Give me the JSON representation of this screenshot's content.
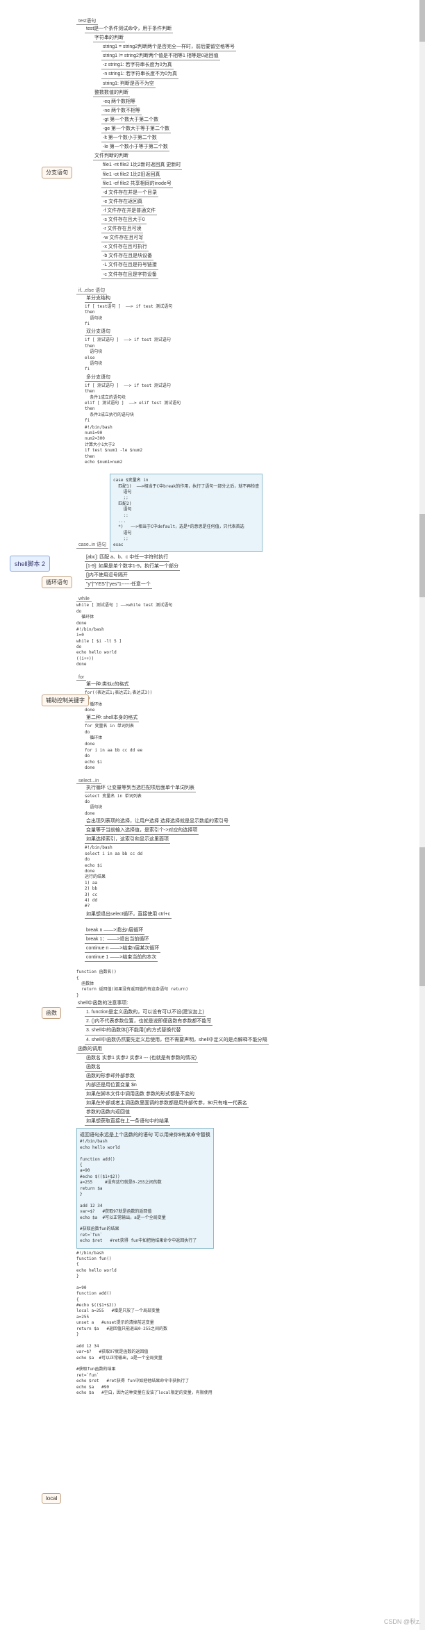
{
  "root": "shell脚本 2",
  "watermark": "CSDN @秋z.",
  "b1": {
    "label": "分支语句",
    "n1": "test语句",
    "n1_desc": "test是一个条件测试命令，用于条件判断",
    "str": {
      "t": "字符串的判断",
      "a": "string1 = string2判断两个是否完全一样时，前后要留空格等号",
      "b": "string1 != string2判断两个值是不相等1 相等是0返回值",
      "c": "-z string1: 若字符串长度为0为真",
      "d": "-n string1: 若字符串长度不为0为真",
      "e": "string1: 判断是否不为空"
    },
    "num": {
      "t": "整数数值的判断",
      "a": "-eq 两个数相等",
      "b": "-ne 两个数不相等",
      "c": "-gt 第一个数大于第二个数",
      "d": "-ge 第一个数大于等于第二个数",
      "e": "-lt 第一个数小于第二个数",
      "f": "-le 第一个数小于等于第二个数"
    },
    "file": {
      "t": "文件判断的判断",
      "a": "file1 -nt file2 1比2新时返回真 更新时",
      "b": "file1 -ot file2 1比2旧返回真",
      "c": "file1 -ef file2 共享相同的inode号",
      "d": "-d 文件存在并是一个目录",
      "e": "-e 文件存在返回真",
      "f": "-f 文件存在并是普通文件",
      "g": "-s 文件存在且大于0",
      "h": "-r 文件存在且可读",
      "i": "-w 文件存在且可写",
      "j": "-x 文件存在且可执行",
      "k": "-b 文件存在且是块设备",
      "l": "-L 文件存在且是符号链接",
      "m": "-c 文件存在且是字符设备"
    },
    "if": {
      "t": "if...else 语句",
      "s1t": "单分支结构",
      "s1a": "if [ test语句 ]  ——> if test 测试语句",
      "s1b": "then",
      "s1c": "  语句块",
      "s1d": "fi",
      "s2t": "双分支语句",
      "s2a": "if [ 测试语句 ]  ——> if test 测试语句",
      "s2b": "then",
      "s2c": "  语句块",
      "s2d": "else",
      "s2e": "  语句块",
      "s2f": "fi",
      "s3t": "多分支语句",
      "s3a": "if [ 测试语句 ]  ——> if test 测试语句",
      "s3b": "then",
      "s3c": "  条件1成立的语句块",
      "s3d": "elif [ 测试语句 ]  ——> elif test 测试语句",
      "s3e": "then",
      "s3f": "  条件2成立执行的语句块",
      "s3g": "fi",
      "ex1": "#!/bin/bash",
      "ex2": "num1=90",
      "ex3": "num2=300",
      "ex4": "计算大小1大于2",
      "ex5": "if test $num1 -le $num2",
      "ex6": "then",
      "ex7": "echo $num1>num2"
    },
    "case": {
      "t": "case..in 语句",
      "h": "case $变量名 in",
      "c1": "  匹配1)  ——>相当于C中break的作用，执行了语句一部分之后，就不再检查",
      "c2": "    语句",
      "c3": "    ;;",
      "c4": "  匹配2)",
      "c5": "    语句",
      "c6": "    ::",
      "c7": "  ...",
      "c8": "  *)   ——>相当于C中default，选是*的意思是任何值，只代表首选",
      "c9": "    语句",
      "c10": "    ;;",
      "c11": "esac",
      "d1": "[abc]: 匹配 a、b、c 中任一字符时执行",
      "d2": "[1-9]: 如果是单个数字1-9，执行某一个部分",
      "d3": "[]内不使用逗号隔开",
      "d4": "\"y\"|\"YES\"|\"yes\"1------任意一个"
    }
  },
  "b2": {
    "label": "循环语句",
    "while": {
      "t": "while",
      "a": "while [ 测试语句 ] ——>while test 测试语句",
      "b": "do",
      "c": "  循环体",
      "d": "done",
      "ex1": "#!/bin/bash",
      "ex2": "i=0",
      "ex3": "while [ $i -lt 5 ]",
      "ex4": "do",
      "ex5": "echo hello world",
      "ex6": "((i++))",
      "ex7": "done"
    },
    "for": {
      "t": "for",
      "f1t": "第一种:类似c的格式",
      "f1a": "for((表达式1;表达式2;表达式3))",
      "f1b": "do",
      "f1c": "  循环体",
      "f1d": "done",
      "f2t": "第二种: shell本身的格式",
      "f2a": "for 变量名 in 单词列表",
      "f2b": "do",
      "f2c": "  循环体",
      "f2d": "done",
      "f3a": "for i in aa bb cc dd ee",
      "f3b": "do",
      "f3c": "echo $i",
      "f3d": "done"
    },
    "select": {
      "t": "select...in",
      "d": "执行循环 让变量等到当选匹配项后面单个单词列表",
      "a": "select 变量名 in 单词列表",
      "b": "do",
      "c": "  语句块",
      "d2": "done",
      "n1": "会出现列表项的选择，让用户选择 选择选择就是显示数组的索引号",
      "n2": "变量等于当前输入选择值，是索引个->对应的选择项",
      "n3": "如果选择索引，这索引和显示这里面项",
      "ex1": "#!/bin/bash",
      "ex2": "select i in aa bb cc dd",
      "ex3": "do",
      "ex4": "echo $i",
      "ex5": "done",
      "ex6": "运行的结果",
      "ex7": "1) aa",
      "ex8": "2) bb",
      "ex9": "3) cc",
      "ex10": "4) dd",
      "ex11": "#?",
      "end": "如果想退出select循环，直接使用 ctrl+c"
    }
  },
  "b3": {
    "label": "辅助控制关键字",
    "a": "break n  ——>退出n层循环",
    "b": "break 1：——>退出当前循环",
    "c": "continue n ——>结束n层某次循环",
    "d": "continue 1 ——>结束当前的本次"
  },
  "b4": {
    "label": "函数",
    "def": {
      "a": "function 函数名()",
      "b": "{",
      "c": "  函数体",
      "d": "  return 返回值(如果没有返回值的有这条语句 return)",
      "e": "}"
    },
    "note": {
      "t": "shell中函数的注意事项:",
      "a": "1. function是定义函数的，可以设有可以不设(建议加上)",
      "b": "2. ()内不代表参数位置，也就是说即便函数有参数都不能写",
      "c": "3. shell中的函数体{}不能用()的方式替换代替",
      "d": "4. shell中函数仍然要先定义后使用，但不需要声明，shell中定义的是点解释不能分隔"
    },
    "call": {
      "t": "函数的调用",
      "a": "函数名 实参1 实参2 实参3 --- (也就是有参数的情况)",
      "b": "函数名",
      "c": "函数的形参却外部参数",
      "d": "内部还是用位置变量 $n",
      "n1": "如果在脚本文件中调用函数 参数的形式都是不变的",
      "n2": "如果在外部或者主调函数里面调的参数都是用外部传参，$0只有唯一代表名",
      "n3": "参数的函数内返回值",
      "n4": "如果想获取直接在上一条语句中的结果"
    },
    "code": {
      "t": "返回语句永远是上个函数的的语句 可以用来你$有某命令替换",
      "a": "#!/bin/bash",
      "b": "echo hello world",
      "c": "function add()",
      "d": "{",
      "e": "a=90",
      "f": "#echo $(($1+$2))",
      "g": "a=255     #没有这行就是0-255之间的数",
      "h": "return $a",
      "i": "}",
      "j": "add 12 34",
      "k": "var=$?   #获取97就是函数的返回值",
      "l": "echo $a  #可以正常输出，a是一个全局变量",
      "m": "#获取函数fun的结果",
      "n": "ret=`fun`",
      "o": "echo $ret   #ret获得 fun中如把他结果命令中返回执行了"
    },
    "code2": {
      "a": "#!/bin/bash",
      "b": "function fun()",
      "c": "{",
      "d": "echo hello world",
      "e": "}",
      "f": "a=90",
      "g": "function add()",
      "h": "{",
      "i": "#echo $(($1+$2))",
      "j": "local a=255   #增是只放了一个局部变量",
      "k": "a=255",
      "l": "unset a   #unset提示的清掉前这变量",
      "m": "return $a   #返回值只能退出0-255之间的数",
      "n": "}",
      "o": "add 12 34",
      "p": "var=$?   #获取97就是函数的返回值",
      "q": "echo $a  #可以正常输出，a是一个全局变量",
      "r": "#获取fun函数的结果",
      "s": "ret=`fun`",
      "t": "echo $ret   #ret获得 fun中如把他结果命令中获执行了",
      "u": "echo $a   #90",
      "v": "echo $a   #空白，因为这种变量在没该了local限定的变量，有限使用"
    }
  },
  "b5": {
    "label": "local"
  }
}
